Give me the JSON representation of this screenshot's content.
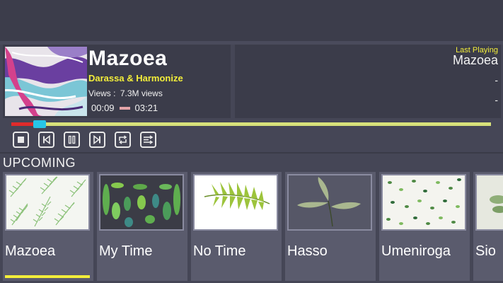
{
  "now_playing": {
    "title": "Mazoea",
    "artist": "Darassa & Harmonize",
    "views_label": "Views :",
    "views_value": "7.3M views",
    "elapsed": "00:09",
    "duration": "03:21",
    "progress_fraction": 0.045
  },
  "last_playing": {
    "label": "Last Playing",
    "title": "Mazoea",
    "line2": "-",
    "line3": "-"
  },
  "controls": {
    "stop_icon": "stop-icon",
    "previous_icon": "skip-previous-icon",
    "pause_icon": "pause-icon",
    "next_icon": "skip-next-icon",
    "repeat_icon": "repeat-icon",
    "shuffle_icon": "shuffle-icon"
  },
  "upcoming": {
    "heading": "UPCOMING",
    "items": [
      {
        "title": "Mazoea",
        "active": true
      },
      {
        "title": "My Time",
        "active": false
      },
      {
        "title": "No Time",
        "active": false
      },
      {
        "title": "Hasso",
        "active": false
      },
      {
        "title": "Umeniroga",
        "active": false
      },
      {
        "title": "Sio",
        "active": false
      }
    ]
  },
  "colors": {
    "background": "#454656",
    "panel": "#3b3c4a",
    "accent_yellow": "#f3ee3a",
    "progress_played": "#e02b2b",
    "progress_thumb": "#27c6e8",
    "progress_remaining": "#d8e27a"
  }
}
